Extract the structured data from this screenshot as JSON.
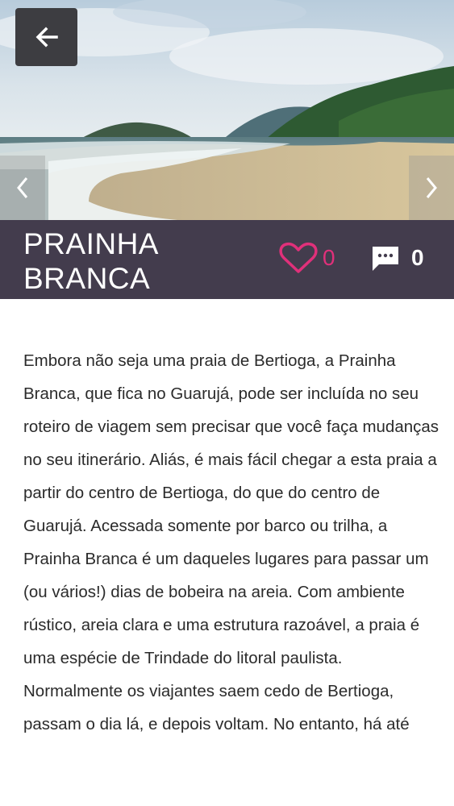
{
  "header": {
    "back_icon": "arrow-left-icon",
    "prev_icon": "chevron-left-icon",
    "next_icon": "chevron-right-icon"
  },
  "place": {
    "title": "PRAINHA BRANCA",
    "likes": "0",
    "comments": "0",
    "like_icon": "heart-outline-icon",
    "comment_icon": "comment-icon",
    "like_color": "#e0307a",
    "bar_color": "#433c4d"
  },
  "description": "Embora não seja uma praia de Bertioga, a Prainha Branca, que fica no Guarujá, pode ser incluída no seu roteiro de viagem sem precisar que você faça mudanças no seu itinerário. Aliás, é mais fácil chegar a esta praia a partir do centro de Bertioga, do que do centro de Guarujá. Acessada somente por barco ou trilha, a Prainha Branca é um daqueles lugares para passar um (ou vários!) dias de bobeira na areia. Com ambiente rústico, areia clara e uma estrutura razoável, a praia é uma espécie de Trindade do litoral paulista. Normalmente os viajantes saem cedo de Bertioga, passam o dia lá, e depois voltam. No entanto, há até"
}
